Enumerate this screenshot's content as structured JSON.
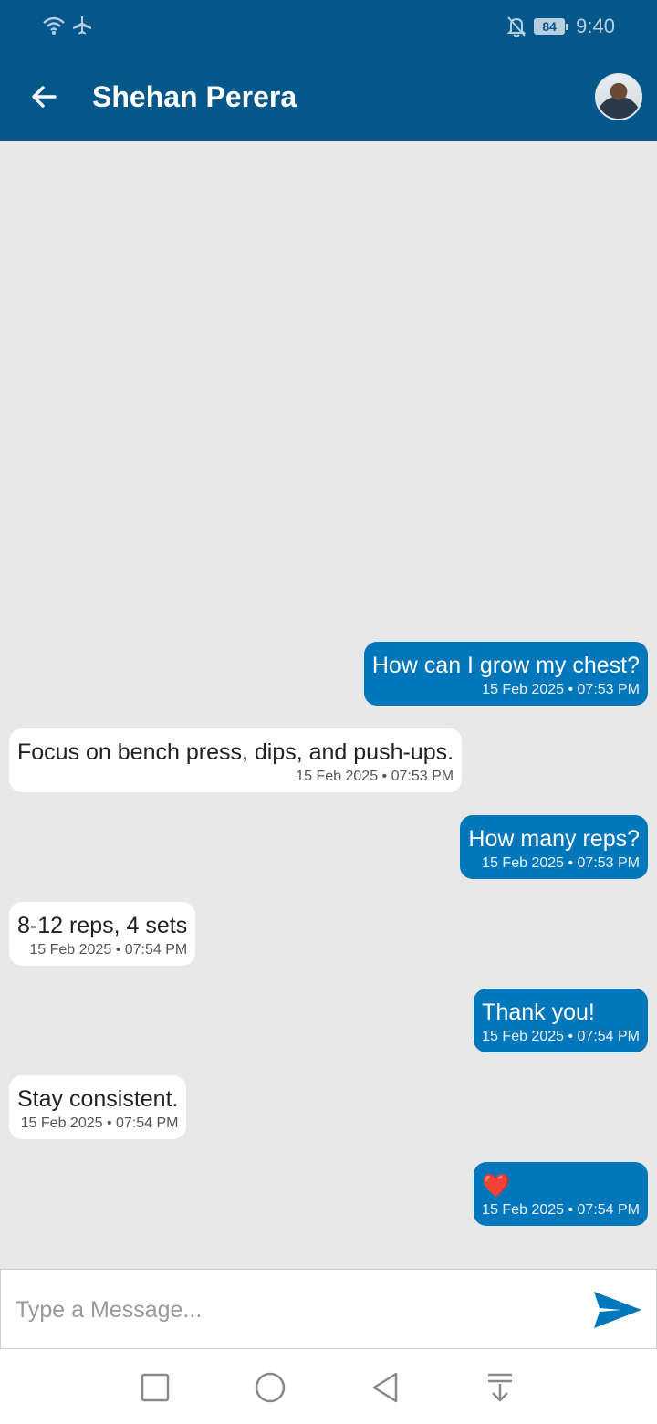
{
  "status": {
    "time": "9:40",
    "battery": "84",
    "icons": [
      "wifi-icon",
      "airplane-icon",
      "bell-off-icon",
      "battery-icon"
    ]
  },
  "header": {
    "title": "Shehan Perera",
    "back_icon": "arrow-back-icon",
    "avatar_icon": "profile-avatar"
  },
  "messages": [
    {
      "direction": "out",
      "text": "How can I grow my chest?",
      "time": "15 Feb 2025 • 07:53 PM"
    },
    {
      "direction": "in",
      "text": "Focus on bench press, dips, and push-ups.",
      "time": "15 Feb 2025 • 07:53 PM"
    },
    {
      "direction": "out",
      "text": "How many reps?",
      "time": "15 Feb 2025 • 07:53 PM"
    },
    {
      "direction": "in",
      "text": "8-12 reps, 4 sets",
      "time": "15 Feb 2025 • 07:54 PM"
    },
    {
      "direction": "out",
      "text": "Thank you!",
      "time": "15 Feb 2025 • 07:54 PM"
    },
    {
      "direction": "in",
      "text": "Stay consistent.",
      "time": "15 Feb 2025 • 07:54 PM"
    },
    {
      "direction": "out",
      "text": "❤️",
      "time": "15 Feb 2025 • 07:54 PM"
    }
  ],
  "composer": {
    "placeholder": "Type a Message...",
    "value": "",
    "send_icon": "send-icon"
  },
  "nav": {
    "icons": [
      "recent-apps-icon",
      "home-icon",
      "back-icon",
      "notification-pull-icon"
    ]
  },
  "colors": {
    "header": "#03578a",
    "outgoing_bubble": "#0177bb",
    "incoming_bubble": "#ffffff",
    "background": "#e8e8e8"
  }
}
